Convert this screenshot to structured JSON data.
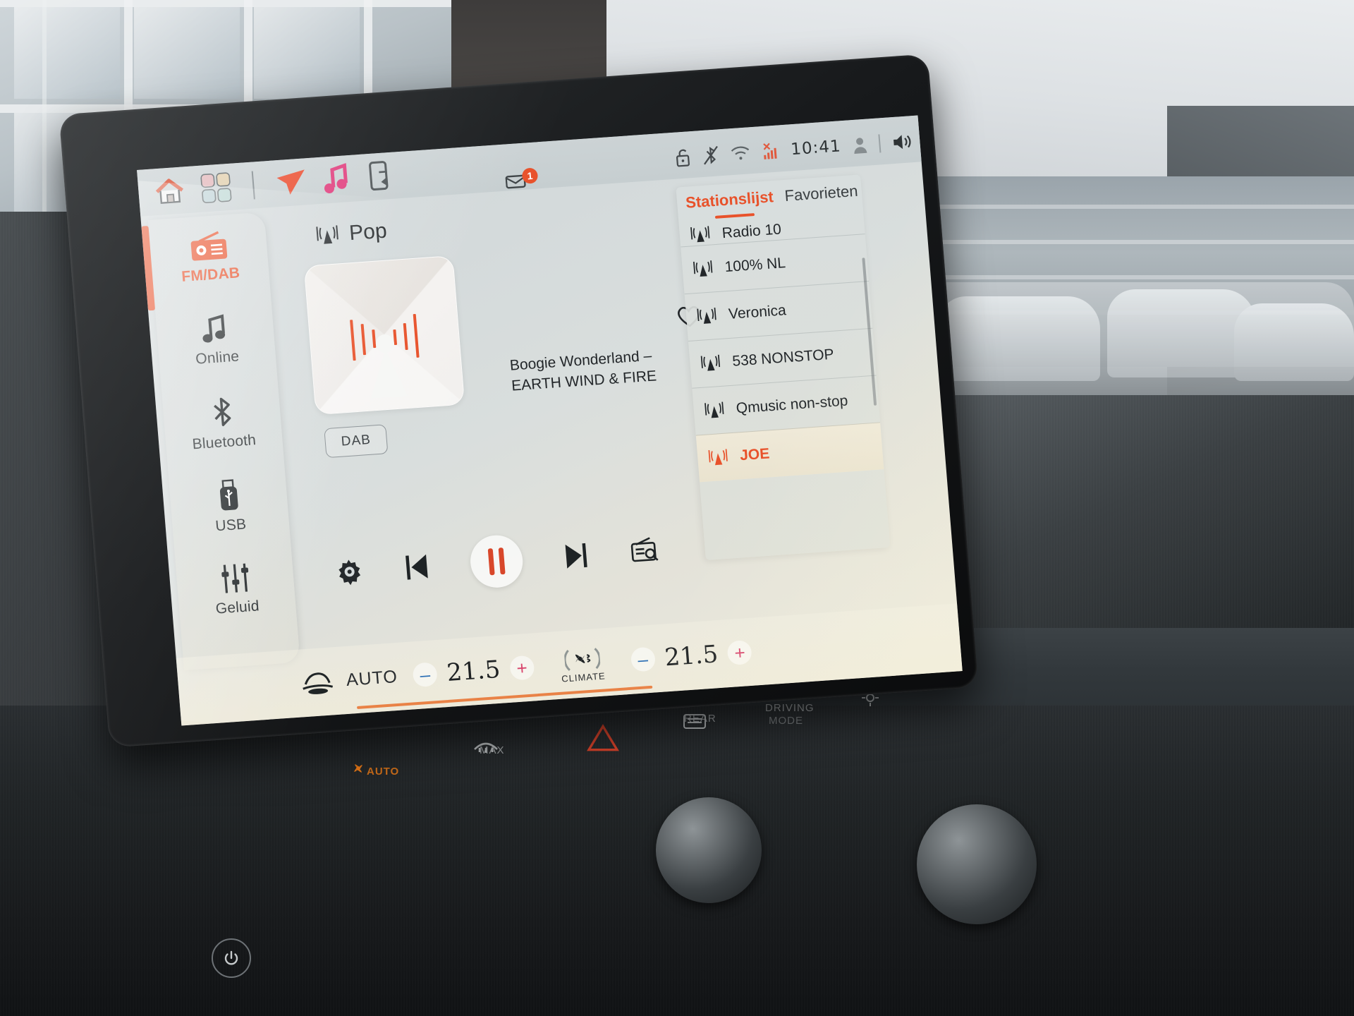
{
  "topbar": {
    "items": [
      {
        "name": "home-icon",
        "label": "Home"
      },
      {
        "name": "apps-grid-icon",
        "label": "Apps"
      },
      {
        "name": "navigation-icon",
        "label": "Navigatie"
      },
      {
        "name": "music-note-icon",
        "label": "Media"
      },
      {
        "name": "phone-projection-icon",
        "label": "Telefoon"
      }
    ]
  },
  "notification": {
    "icon": "message-icon",
    "count": "1"
  },
  "statusbar": {
    "unlock_icon": "unlock-icon",
    "bluetooth_off_icon": "bluetooth-off-icon",
    "wifi_icon": "wifi-icon",
    "cellular_icon": "cellular-no-service-icon",
    "time": "10:41",
    "profile_icon": "user-profile-icon",
    "volume_icon": "speaker-volume-icon"
  },
  "sidebar": {
    "items": [
      {
        "label": "FM/DAB",
        "icon": "radio-icon",
        "active": true
      },
      {
        "label": "Online",
        "icon": "music-note-icon",
        "active": false
      },
      {
        "label": "Bluetooth",
        "icon": "bluetooth-icon",
        "active": false
      },
      {
        "label": "USB",
        "icon": "usb-stick-icon",
        "active": false
      },
      {
        "label": "Geluid",
        "icon": "equalizer-sliders-icon",
        "active": false
      }
    ]
  },
  "player": {
    "genre": "Pop",
    "genre_icon": "radio-tower-icon",
    "track": "Boogie Wonderland – EARTH WIND & FIRE",
    "band_badge": "DAB",
    "favorite_icon": "heart-outline-icon",
    "controls": [
      {
        "name": "settings-gear-button",
        "icon": "gear-icon"
      },
      {
        "name": "previous-track-button",
        "icon": "skip-previous-icon"
      },
      {
        "name": "play-pause-button",
        "icon": "pause-icon"
      },
      {
        "name": "next-track-button",
        "icon": "skip-next-icon"
      },
      {
        "name": "station-scan-button",
        "icon": "radio-search-icon"
      }
    ]
  },
  "stationlist": {
    "tab_active": "Stationslijst",
    "tab_chevron": "chevron-down-icon",
    "tab_inactive": "Favorieten",
    "search_icon": "search-icon",
    "stations": [
      {
        "name": "Radio 10",
        "selected": false,
        "partial": true
      },
      {
        "name": "100% NL",
        "selected": false,
        "partial": false
      },
      {
        "name": "Veronica",
        "selected": false,
        "partial": false
      },
      {
        "name": "538 NONSTOP",
        "selected": false,
        "partial": false
      },
      {
        "name": "Qmusic non-stop",
        "selected": false,
        "partial": false
      },
      {
        "name": "JOE",
        "selected": true,
        "partial": false
      }
    ]
  },
  "climate": {
    "seat_icon": "seat-heater-icon",
    "auto_label": "AUTO",
    "left_temp": "21.5",
    "right_temp": "21.5",
    "minus_label": "–",
    "plus_label": "+",
    "climate_label": "CLIMATE",
    "climate_icon": "fan-icon"
  },
  "hardware": {
    "auto_label": "AUTO",
    "max_label": "MAX",
    "rear_label": "REAR",
    "driving_label": "DRIVING",
    "mode_label": "MODE",
    "hazard_icon": "hazard-triangle-icon",
    "power_icon": "power-icon",
    "defrost_front_icon": "defrost-front-icon",
    "defrost_rear_icon": "defrost-rear-icon",
    "fan-auto-icon": "fan-auto-icon",
    "settings_icon": "settings-icon"
  },
  "colors": {
    "accent": "#e8522b",
    "screen_bg": "#d5dbdc",
    "text": "#23272a",
    "selected_row_bg": "#ece5d2"
  }
}
